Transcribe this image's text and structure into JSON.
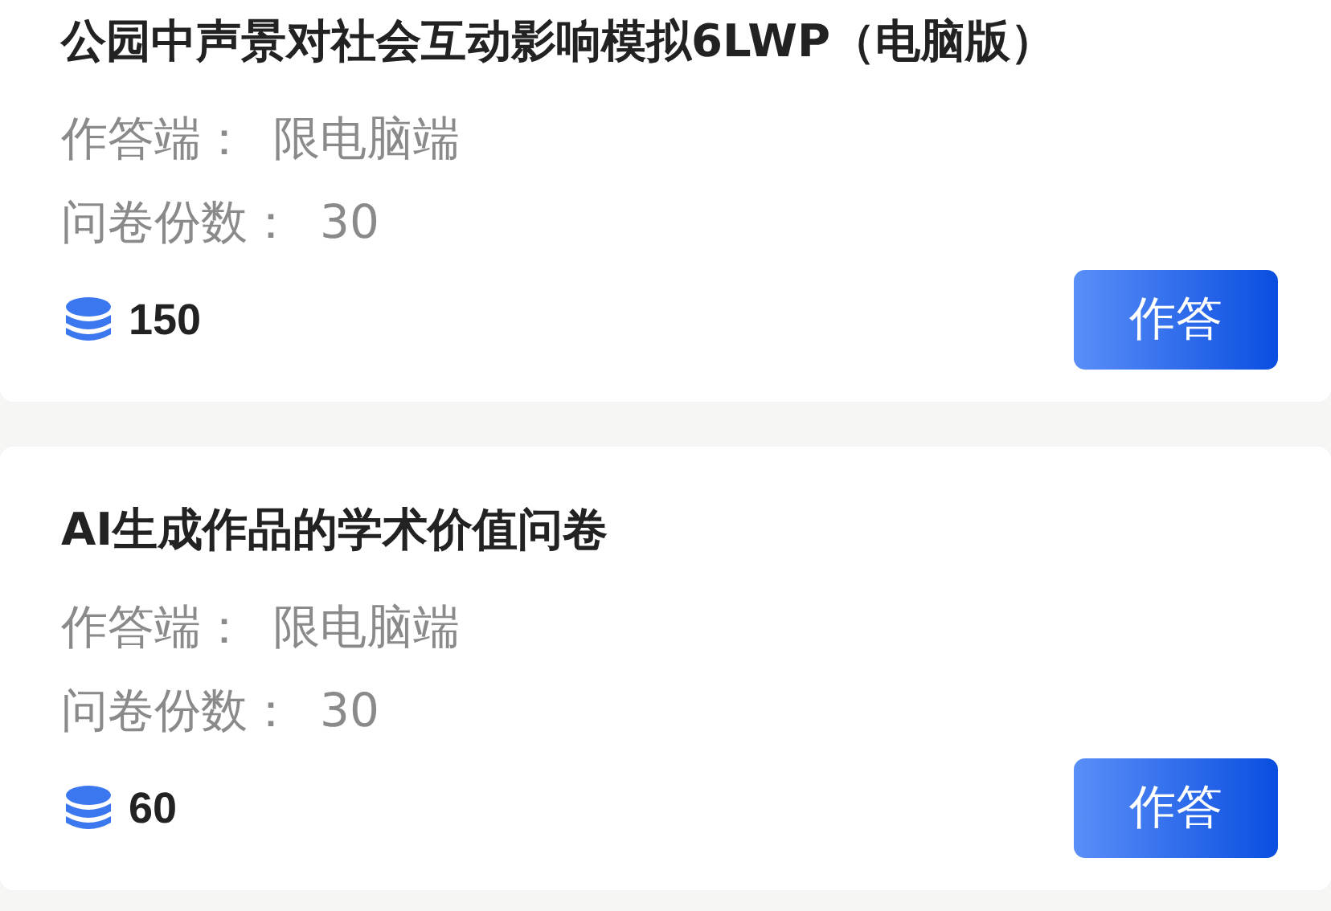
{
  "surveys": [
    {
      "title": "公园中声景对社会互动影响模拟6LWP（电脑版）",
      "fields": [
        {
          "label": "作答端：",
          "value": "限电脑端"
        },
        {
          "label": "问卷份数：",
          "value": "30"
        }
      ],
      "points": "150",
      "button": "作答"
    },
    {
      "title": "AI生成作品的学术价值问卷",
      "fields": [
        {
          "label": "作答端：",
          "value": "限电脑端"
        },
        {
          "label": "问卷份数：",
          "value": "30"
        }
      ],
      "points": "60",
      "button": "作答"
    }
  ]
}
